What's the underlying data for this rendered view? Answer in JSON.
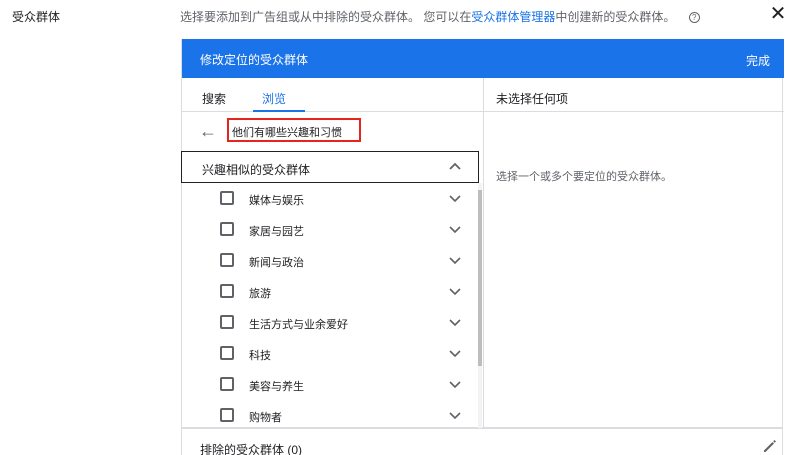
{
  "section": {
    "label": "受众群体"
  },
  "top_description": {
    "text_before": "选择要添加到广告组或从中排除的受众群体。 您可以在",
    "link": "受众群体管理器",
    "text_after": "中创建新的受众群体。",
    "help_glyph": "?",
    "close_glyph": "✕"
  },
  "panel": {
    "title": "修改定位的受众群体",
    "done_label": "完成",
    "header_color": "#1a73e8"
  },
  "tabs": [
    {
      "label": "搜索",
      "active": false
    },
    {
      "label": "浏览",
      "active": true
    }
  ],
  "breadcrumb": {
    "back_glyph": "←",
    "text": "他们有哪些兴趣和习惯"
  },
  "category": {
    "label": "兴趣相似的受众群体"
  },
  "items": [
    {
      "label": "媒体与娱乐"
    },
    {
      "label": "家居与园艺"
    },
    {
      "label": "新闻与政治"
    },
    {
      "label": "旅游"
    },
    {
      "label": "生活方式与业余爱好"
    },
    {
      "label": "科技"
    },
    {
      "label": "美容与养生"
    },
    {
      "label": "购物者"
    }
  ],
  "right_panel": {
    "header": "未选择任何项",
    "hint": "选择一个或多个要定位的受众群体。"
  },
  "excluded": {
    "label": "排除的受众群体 (0)"
  },
  "colors": {
    "accent": "#1a73e8",
    "highlight_border": "#e3251d"
  }
}
